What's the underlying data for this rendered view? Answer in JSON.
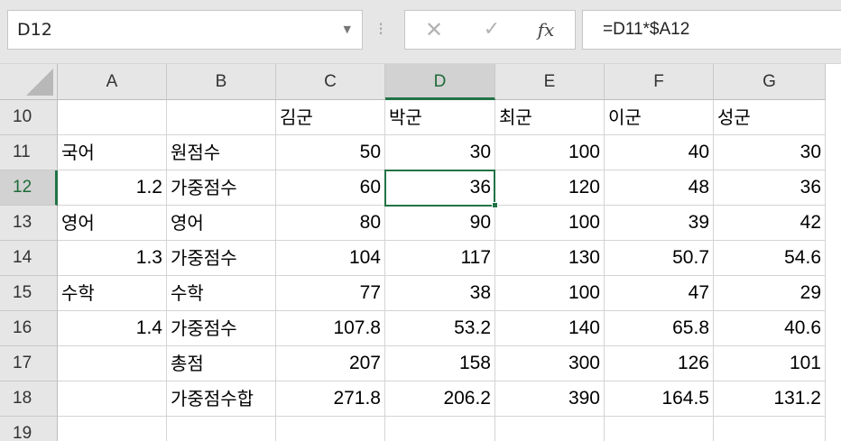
{
  "formula_bar": {
    "name_box": "D12",
    "name_box_dropdown_icon": "chevron-down-icon",
    "separator_icon": "vertical-dots-icon",
    "cancel_icon": "x-icon",
    "enter_icon": "checkmark-icon",
    "function_icon_label": "fx",
    "formula": "=D11*$A12"
  },
  "accent_color": "#217346",
  "selected_cell": "D12",
  "columns": [
    "A",
    "B",
    "C",
    "D",
    "E",
    "F",
    "G"
  ],
  "rows": [
    {
      "num": "10",
      "cells": [
        "",
        "",
        "김군",
        "박군",
        "최군",
        "이군",
        "성군"
      ]
    },
    {
      "num": "11",
      "cells": [
        "국어",
        "원점수",
        "50",
        "30",
        "100",
        "40",
        "30"
      ]
    },
    {
      "num": "12",
      "cells": [
        "1.2",
        "가중점수",
        "60",
        "36",
        "120",
        "48",
        "36"
      ]
    },
    {
      "num": "13",
      "cells": [
        "영어",
        "영어",
        "80",
        "90",
        "100",
        "39",
        "42"
      ]
    },
    {
      "num": "14",
      "cells": [
        "1.3",
        "가중점수",
        "104",
        "117",
        "130",
        "50.7",
        "54.6"
      ]
    },
    {
      "num": "15",
      "cells": [
        "수학",
        "수학",
        "77",
        "38",
        "100",
        "47",
        "29"
      ]
    },
    {
      "num": "16",
      "cells": [
        "1.4",
        "가중점수",
        "107.8",
        "53.2",
        "140",
        "65.8",
        "40.6"
      ]
    },
    {
      "num": "17",
      "cells": [
        "",
        "총점",
        "207",
        "158",
        "300",
        "126",
        "101"
      ]
    },
    {
      "num": "18",
      "cells": [
        "",
        "가중점수합",
        "271.8",
        "206.2",
        "390",
        "164.5",
        "131.2"
      ]
    },
    {
      "num": "19",
      "cells": [
        "",
        "",
        "",
        "",
        "",
        "",
        ""
      ]
    }
  ]
}
